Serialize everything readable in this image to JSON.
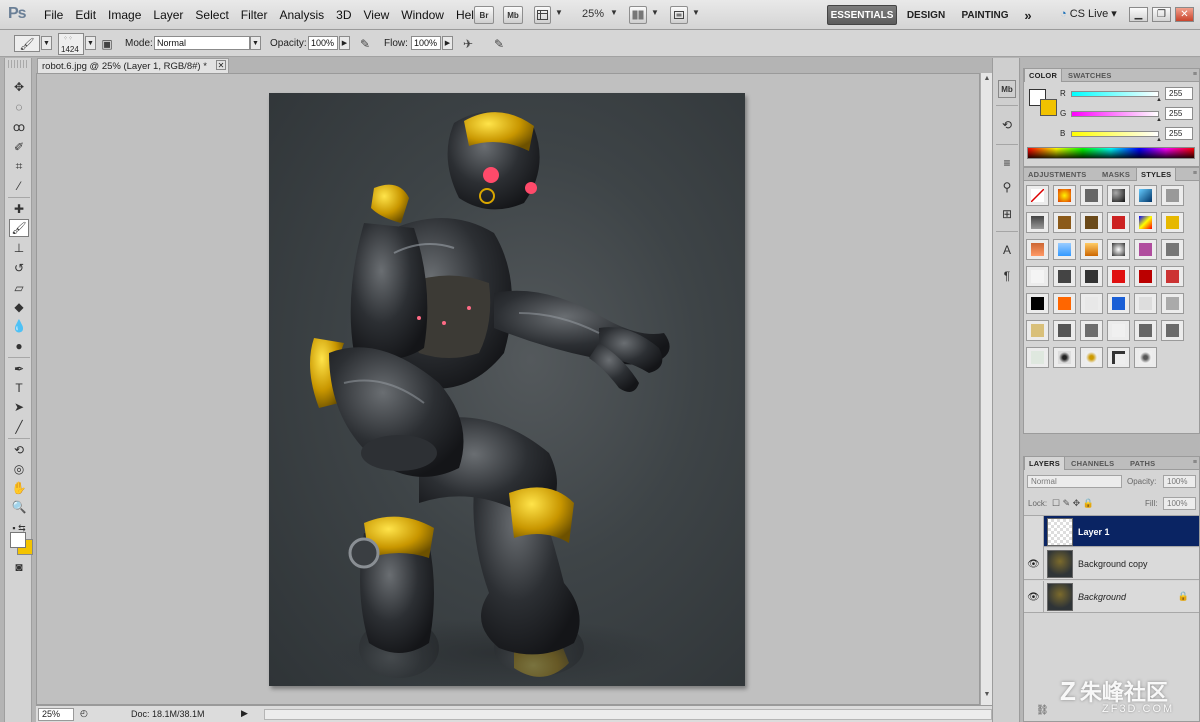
{
  "app": {
    "logo": "Ps"
  },
  "menu": [
    "File",
    "Edit",
    "Image",
    "Layer",
    "Select",
    "Filter",
    "Analysis",
    "3D",
    "View",
    "Window",
    "Help"
  ],
  "appbar": {
    "bridge": "Br",
    "minibridge": "Mb",
    "zoom": "25%"
  },
  "workspaces": {
    "essentials": "ESSENTIALS",
    "design": "DESIGN",
    "painting": "PAINTING",
    "more": "»"
  },
  "cslive": "CS Live",
  "options": {
    "brush_size": "1424",
    "mode_label": "Mode:",
    "mode_value": "Normal",
    "opacity_label": "Opacity:",
    "opacity_value": "100%",
    "flow_label": "Flow:",
    "flow_value": "100%"
  },
  "document": {
    "tab_title": "robot.6.jpg @ 25% (Layer 1, RGB/8#) *",
    "status_zoom": "25%",
    "status_doc": "Doc: 18.1M/38.1M"
  },
  "color_panel": {
    "tabs": [
      "COLOR",
      "SWATCHES"
    ],
    "channels": [
      {
        "label": "R",
        "value": "255"
      },
      {
        "label": "G",
        "value": "255"
      },
      {
        "label": "B",
        "value": "255"
      }
    ],
    "foreground": "#ffffff",
    "background": "#f1c200"
  },
  "styles_panel": {
    "tabs": [
      "ADJUSTMENTS",
      "MASKS",
      "STYLES"
    ]
  },
  "layers_panel": {
    "tabs": [
      "LAYERS",
      "CHANNELS",
      "PATHS"
    ],
    "blend_mode": "Normal",
    "opacity_label": "Opacity:",
    "opacity_value": "100%",
    "lock_label": "Lock:",
    "fill_label": "Fill:",
    "fill_value": "100%",
    "layers": [
      {
        "name": "Layer 1",
        "visible": false,
        "selected": true
      },
      {
        "name": "Background copy",
        "visible": true,
        "selected": false
      },
      {
        "name": "Background",
        "visible": true,
        "selected": false,
        "locked": true
      }
    ]
  },
  "watermark": {
    "text": "朱峰社区",
    "url": "ZF3D.COM"
  }
}
